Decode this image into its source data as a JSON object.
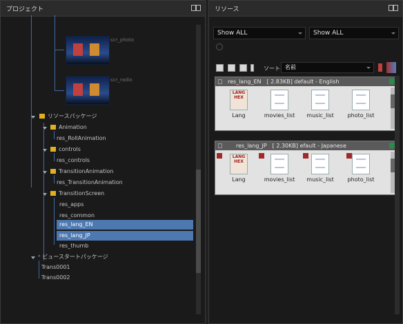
{
  "project_panel": {
    "title": "プロジェクト",
    "thumbnails": [
      {
        "caption": "scr_photo"
      },
      {
        "caption": "scr_radio"
      }
    ],
    "tree": {
      "resource_package": "リソースパッケージ",
      "animation": "Animation",
      "res_roll": "res_RollAnimation",
      "controls": "controls",
      "res_controls": "res_controls",
      "transition_animation": "TransitionAnimation",
      "res_transition": "res_TransitionAnimation",
      "transition_screen": "TransitionScreen",
      "leaves": [
        "res_apps",
        "res_common",
        "res_lang_EN",
        "res_lang_JP",
        "res_thumb"
      ],
      "view_start": "ビュースタートパッケージ",
      "trans1": "Trans0001",
      "trans2": "Trans0002"
    }
  },
  "resource_panel": {
    "title": "リソース",
    "filter1": "Show ALL",
    "filter2": "Show ALL",
    "sort_label": "ソート:",
    "sort_value": "名前",
    "groups": [
      {
        "header": "res_lang_EN　[ 2.83KB]  default - English",
        "items": [
          {
            "label": "Lang",
            "icon": "LANG HEX"
          },
          {
            "label": "movies_list",
            "icon": "MODEL LIST"
          },
          {
            "label": "music_list",
            "icon": "MODEL LIST"
          },
          {
            "label": "photo_list",
            "icon": "MODEL LIST"
          }
        ]
      },
      {
        "header": "res_lang_JP　[ 2.30KB]  efault - Japanese",
        "items": [
          {
            "label": "Lang",
            "icon": "LANG HEX"
          },
          {
            "label": "movies_list",
            "icon": "MODEL LIST"
          },
          {
            "label": "music_list",
            "icon": "MODEL LIST"
          },
          {
            "label": "photo_list",
            "icon": "MODEL LIST"
          }
        ]
      }
    ]
  },
  "colors": {
    "selection": "#4d78b0",
    "folder": "#e0b020",
    "panel_bg": "#1a1a1a",
    "group_bg": "#e2e2e2"
  }
}
